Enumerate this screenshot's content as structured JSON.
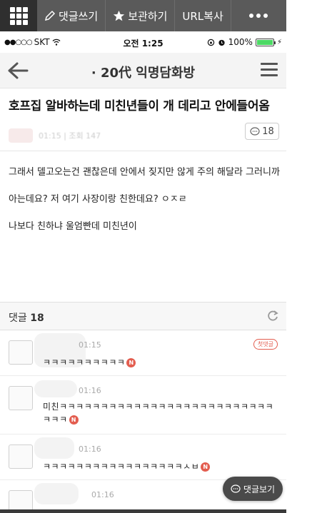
{
  "toolbar": {
    "write_comment": "댓글쓰기",
    "bookmark": "보관하기",
    "copy_url": "URL복사"
  },
  "statusbar": {
    "carrier": "SKT",
    "time": "오전 1:25",
    "battery": "100%",
    "battery_level": 1.0
  },
  "nav": {
    "title": "· 20代 익명담화방"
  },
  "post": {
    "title": "호프집 알바하는데 미친년들이 개 데리고 안에들어옴",
    "meta": "01:15 | 조회 147",
    "comment_count": "18",
    "paragraphs": [
      "그래서 델고오는건 괜찮은데 안에서 짖지만 않게 주의 해달라 그러니까",
      "아는데요? 저 여기 사장이랑 친한데요? ㅇㅈㄹ",
      "나보다 친하냐 울엄빤데 미친년이"
    ]
  },
  "comments_header": {
    "label": "댓글",
    "count": "18"
  },
  "comments": [
    {
      "time": "01:15",
      "text": "ㅋㅋㅋㅋㅋㅋㅋㅋㅋㅋ",
      "badge": "N",
      "first_label": "첫댓글"
    },
    {
      "time": "01:16",
      "text": "미친ㅋㅋㅋㅋㅋㅋㅋㅋㅋㅋㅋㅋㅋㅋㅋㅋㅋㅋㅋㅋㅋㅋㅋㅋㅋㅋㅋㅋㅋ",
      "badge": "N"
    },
    {
      "time": "01:16",
      "text": "ㅋㅋㅋㅋㅋㅋㅋㅋㅋㅋㅋㅋㅋㅋㅋㅋㅋㅅㅂ",
      "badge": "N"
    },
    {
      "time": "01:16",
      "text": ""
    }
  ],
  "view_comments_button": "댓글보기"
}
